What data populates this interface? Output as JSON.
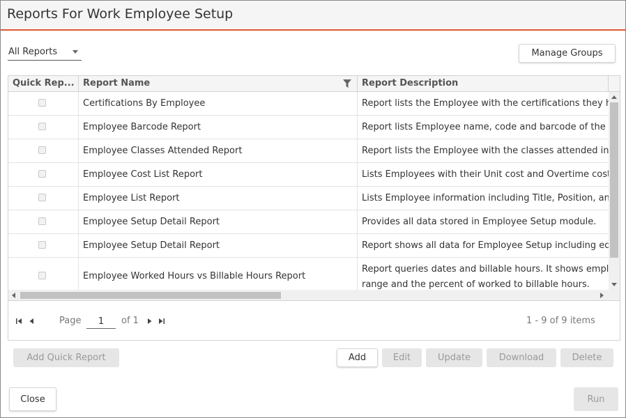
{
  "dialog": {
    "title": "Reports For Work Employee Setup",
    "accent_color": "#e2562f"
  },
  "filter": {
    "selected": "All Reports"
  },
  "toolbar": {
    "manage_groups": "Manage Groups"
  },
  "grid": {
    "columns": [
      "Quick Rep...",
      "Report Name",
      "Report Description"
    ],
    "rows": [
      {
        "name": "Certifications By Employee",
        "description": "Report lists the Employee with the certifications they h"
      },
      {
        "name": "Employee Barcode Report",
        "description": "Report lists Employee name, code and barcode of the e"
      },
      {
        "name": "Employee Classes Attended Report",
        "description": "Report lists the Employee with the classes attended in"
      },
      {
        "name": "Employee Cost List Report",
        "description": "Lists Employees with their Unit cost and Overtime cost"
      },
      {
        "name": "Employee List Report",
        "description": "Lists Employee information including Title, Position, an"
      },
      {
        "name": "Employee Setup Detail Report",
        "description": "Provides all data stored in Employee Setup module."
      },
      {
        "name": "Employee Setup Detail Report",
        "description": "Report shows all data for Employee Setup including eq"
      },
      {
        "name": "Employee Worked Hours vs Billable Hours Report",
        "description": "Report queries dates and billable hours. It shows empl",
        "description_line2": "range and the percent of worked to billable hours."
      }
    ]
  },
  "pager": {
    "page_label": "Page",
    "page_value": "1",
    "of_label": "of 1",
    "items_summary": "1 - 9 of 9 items"
  },
  "actions": {
    "add_quick_report": "Add Quick Report",
    "add": "Add",
    "edit": "Edit",
    "update": "Update",
    "download": "Download",
    "delete": "Delete"
  },
  "footer": {
    "close": "Close",
    "run": "Run"
  }
}
